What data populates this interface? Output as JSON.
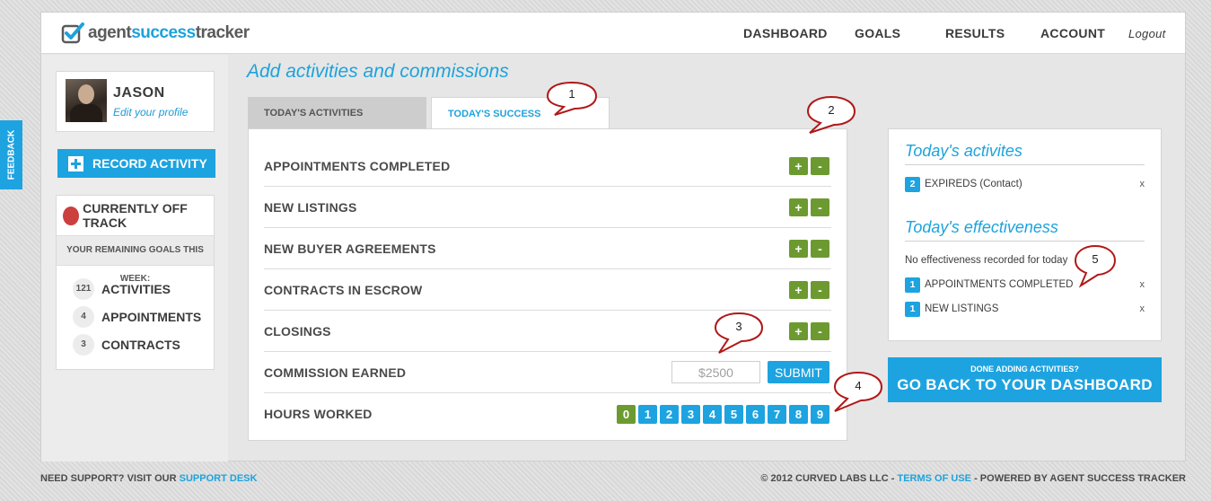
{
  "app": {
    "logo_parts": [
      "agent",
      "success",
      "tracker"
    ]
  },
  "nav": {
    "dashboard": "DASHBOARD",
    "goals": "GOALS",
    "results": "RESULTS",
    "account": "ACCOUNT",
    "logout": "Logout"
  },
  "feedback": "FEEDBACK",
  "profile": {
    "name": "JASON",
    "edit": "Edit your profile"
  },
  "record_activity": "RECORD ACTIVITY",
  "track": {
    "status": "CURRENTLY OFF TRACK",
    "status_color": "#cc3f3f",
    "subheading": "YOUR REMAINING GOALS THIS WEEK:",
    "goals": [
      {
        "count": "121",
        "label": "ACTIVITIES"
      },
      {
        "count": "4",
        "label": "APPOINTMENTS"
      },
      {
        "count": "3",
        "label": "CONTRACTS"
      }
    ]
  },
  "main": {
    "title": "Add activities and commissions",
    "tabs": [
      {
        "label": "TODAY'S ACTIVITIES",
        "active": false
      },
      {
        "label": "TODAY'S SUCCESS",
        "active": true
      }
    ],
    "rows": [
      {
        "label": "APPOINTMENTS COMPLETED"
      },
      {
        "label": "NEW LISTINGS"
      },
      {
        "label": "NEW BUYER AGREEMENTS"
      },
      {
        "label": "CONTRACTS IN ESCROW"
      },
      {
        "label": "CLOSINGS"
      }
    ],
    "plus": "+",
    "minus": "-",
    "commission": {
      "label": "COMMISSION EARNED",
      "placeholder": "$2500",
      "submit": "SUBMIT"
    },
    "hours": {
      "label": "HOURS WORKED",
      "options": [
        "0",
        "1",
        "2",
        "3",
        "4",
        "5",
        "6",
        "7",
        "8",
        "9"
      ],
      "selected": "0"
    }
  },
  "sidebar": {
    "activities_title": "Today's activites",
    "activities": [
      {
        "count": "2",
        "label": "EXPIREDS (Contact)",
        "remove": "x"
      }
    ],
    "effectiveness_title": "Today's effectiveness",
    "no_effectiveness": "No effectiveness recorded for today",
    "effectiveness": [
      {
        "count": "1",
        "label": "APPOINTMENTS COMPLETED",
        "remove": "x"
      },
      {
        "count": "1",
        "label": "NEW LISTINGS",
        "remove": "x"
      }
    ]
  },
  "done": {
    "small": "DONE ADDING ACTIVITIES?",
    "big": "GO BACK TO YOUR DASHBOARD"
  },
  "footer": {
    "support_prefix": "NEED SUPPORT? VISIT OUR",
    "support_link": "SUPPORT DESK",
    "copyright": "© 2012 CURVED LABS LLC -",
    "terms": "TERMS OF USE",
    "powered": "- POWERED BY AGENT SUCCESS TRACKER"
  },
  "callouts": [
    "1",
    "2",
    "3",
    "4",
    "5"
  ],
  "colors": {
    "accent": "#1da3e0",
    "green": "#6c9a30",
    "callout_red": "#b01818"
  }
}
